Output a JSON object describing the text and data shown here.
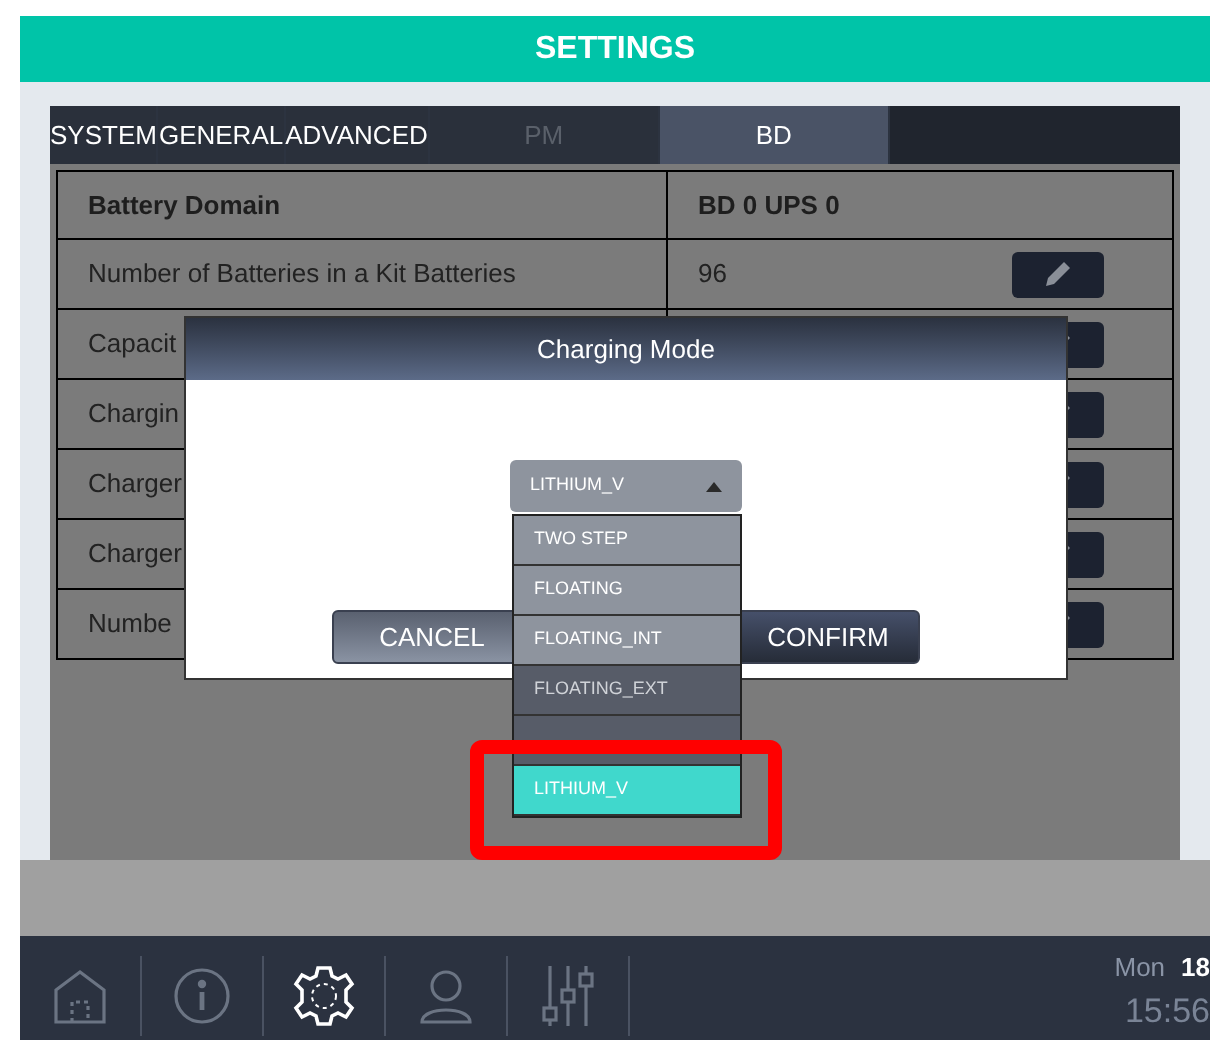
{
  "header": {
    "title": "SETTINGS"
  },
  "tabs": [
    {
      "label": "SYSTEM",
      "selected": false,
      "disabled": false
    },
    {
      "label": "GENERAL",
      "selected": false,
      "disabled": false
    },
    {
      "label": "ADVANCED",
      "selected": false,
      "disabled": false
    },
    {
      "label": "PM",
      "selected": false,
      "disabled": true
    },
    {
      "label": "BD",
      "selected": true,
      "disabled": false
    }
  ],
  "table": {
    "header": {
      "label": "Battery Domain",
      "value": "BD 0 UPS 0"
    },
    "rows": [
      {
        "label": "Number of Batteries in a Kit Batteries",
        "value": "96"
      },
      {
        "label": "Capacit"
      },
      {
        "label": "Chargin"
      },
      {
        "label": "Charger"
      },
      {
        "label": "Charger"
      },
      {
        "label": "Numbe"
      }
    ]
  },
  "dialog": {
    "title": "Charging Mode",
    "dropdown": {
      "value": "LITHIUM_V",
      "expanded": true,
      "options": [
        {
          "kind": "option",
          "label": "TWO STEP",
          "selected": false
        },
        {
          "kind": "option",
          "label": "FLOATING",
          "selected": false
        },
        {
          "kind": "option",
          "label": "FLOATING_INT",
          "selected": false
        },
        {
          "kind": "option",
          "label": "FLOATING_EXT",
          "selected": false
        },
        {
          "kind": "blank",
          "selected": false
        },
        {
          "kind": "option",
          "label": "LITHIUM_V",
          "selected": true
        }
      ]
    },
    "buttons": [
      {
        "kind": "cancel",
        "label": "CANCEL"
      },
      {
        "kind": "confirm",
        "label": "CONFIRM"
      }
    ]
  },
  "taskbar": {
    "items": [
      {
        "kind": "home",
        "selected": false
      },
      {
        "kind": "info",
        "selected": false
      },
      {
        "kind": "settings",
        "selected": true
      },
      {
        "kind": "user",
        "selected": false
      },
      {
        "kind": "sliders",
        "selected": false
      }
    ],
    "day": "Mon",
    "date": "18",
    "time": "15:56"
  }
}
